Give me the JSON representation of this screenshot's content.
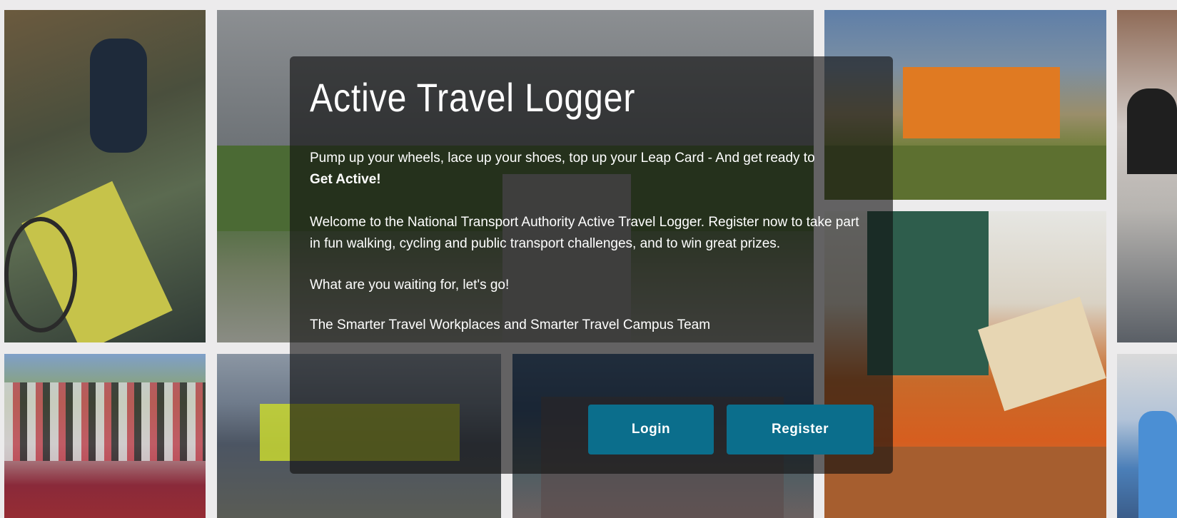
{
  "hero": {
    "title": "Active Travel Logger",
    "intro_text": "Pump up your wheels, lace up your shoes, top up your Leap Card - And get ready to ",
    "intro_bold": "Get Active!",
    "welcome": "Welcome to the National Transport Authority Active Travel Logger. Register now to take part in fun walking, cycling and public transport challenges, and to win great prizes.",
    "cta": "What are you waiting for, let's go!",
    "signature": "The Smarter Travel Workplaces and Smarter Travel Campus Team"
  },
  "buttons": {
    "login": "Login",
    "register": "Register"
  },
  "colors": {
    "button": "#0b6e8c",
    "panel": "rgba(15,15,15,0.62)",
    "text": "#ffffff"
  }
}
